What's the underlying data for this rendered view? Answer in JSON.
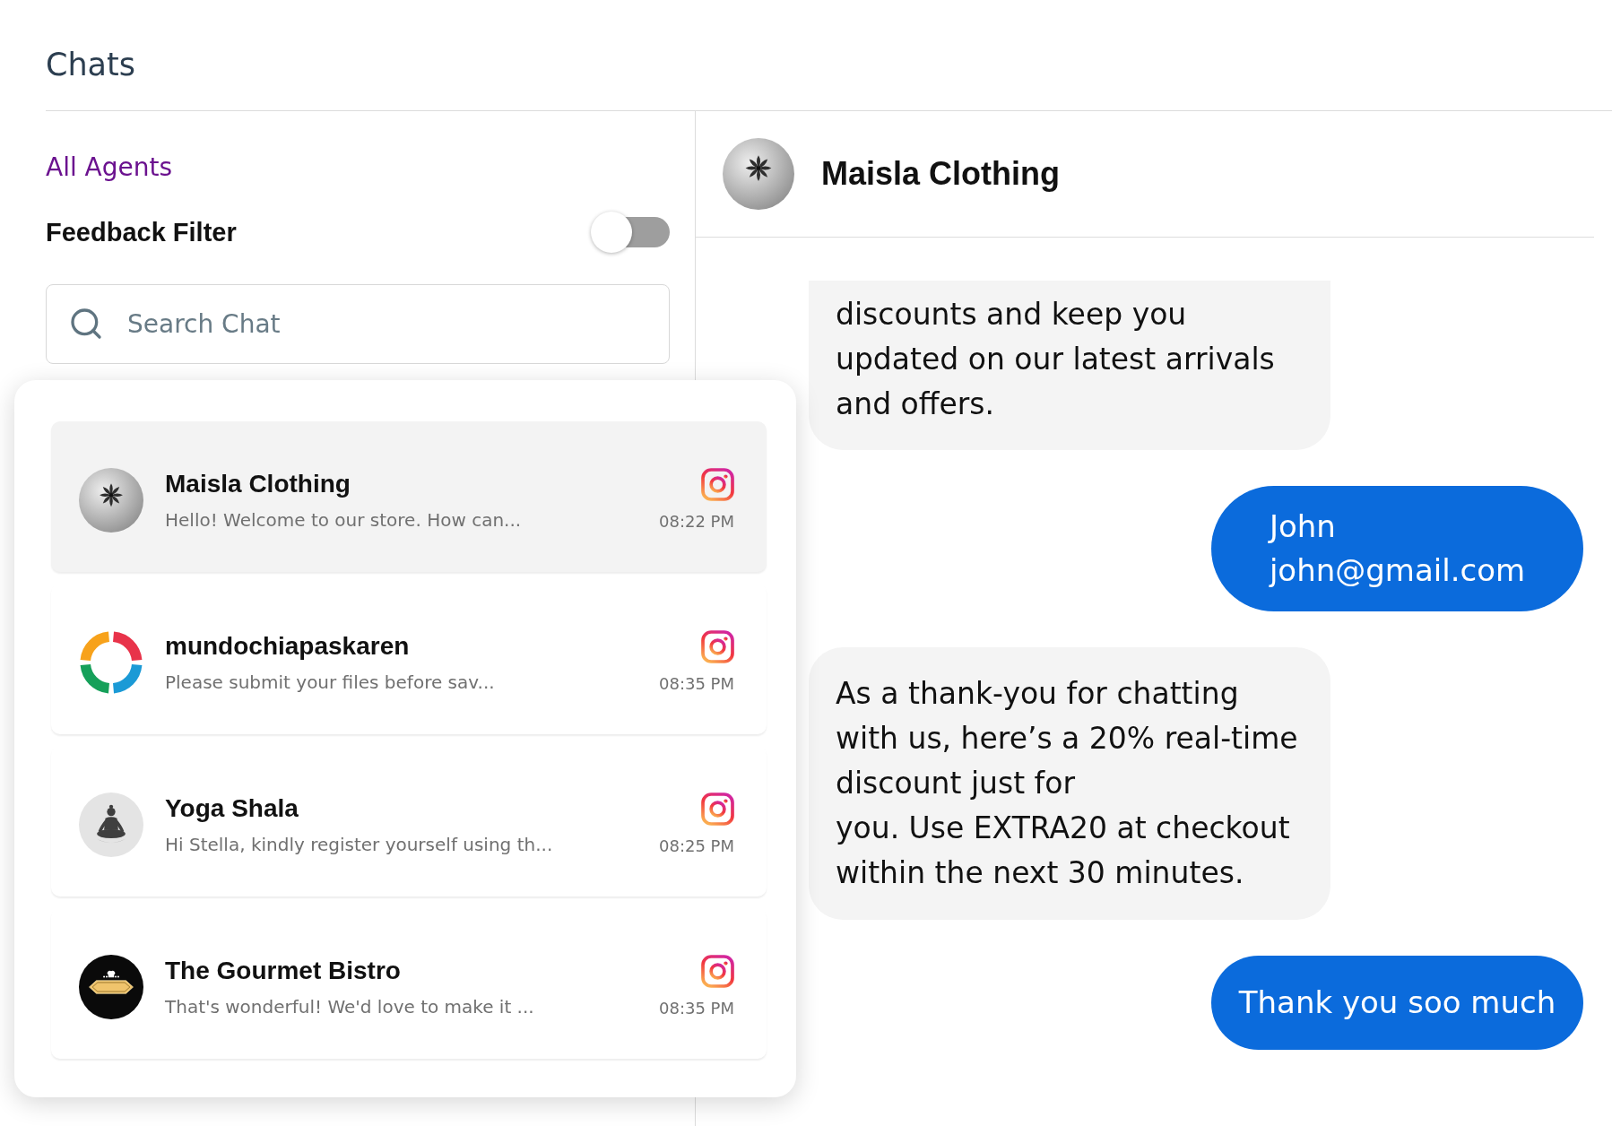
{
  "header": {
    "title": "Chats"
  },
  "sidebar": {
    "agent_filter": "All Agents",
    "feedback_filter": {
      "label": "Feedback Filter",
      "on": false
    },
    "search": {
      "placeholder": "Search Chat"
    }
  },
  "chat_list": [
    {
      "name": "Maisla Clothing",
      "preview": "Hello! Welcome to our store. How can...",
      "time": "08:22 PM",
      "selected": true
    },
    {
      "name": "mundochiapaskaren",
      "preview": "Please submit your files before sav...",
      "time": "08:35 PM",
      "selected": false
    },
    {
      "name": "Yoga Shala",
      "preview": "Hi Stella, kindly register yourself using th...",
      "time": "08:25 PM",
      "selected": false
    },
    {
      "name": "The Gourmet Bistro",
      "preview": "That's wonderful! We'd love to make it ...",
      "time": "08:35 PM",
      "selected": false
    }
  ],
  "conversation": {
    "contact": {
      "name": "Maisla Clothing"
    },
    "messages": [
      {
        "kind": "incoming",
        "text": "discounts and keep you updated on our latest arrivals and offers."
      },
      {
        "kind": "outgoing",
        "text": "John\njohn@gmail.com"
      },
      {
        "kind": "incoming",
        "text": "As a thank-you for chatting with us, here’s a 20% real-time discount just for\nyou. Use EXTRA20 at checkout within the next 30 minutes."
      },
      {
        "kind": "outgoing",
        "text": "Thank you soo much"
      }
    ]
  }
}
